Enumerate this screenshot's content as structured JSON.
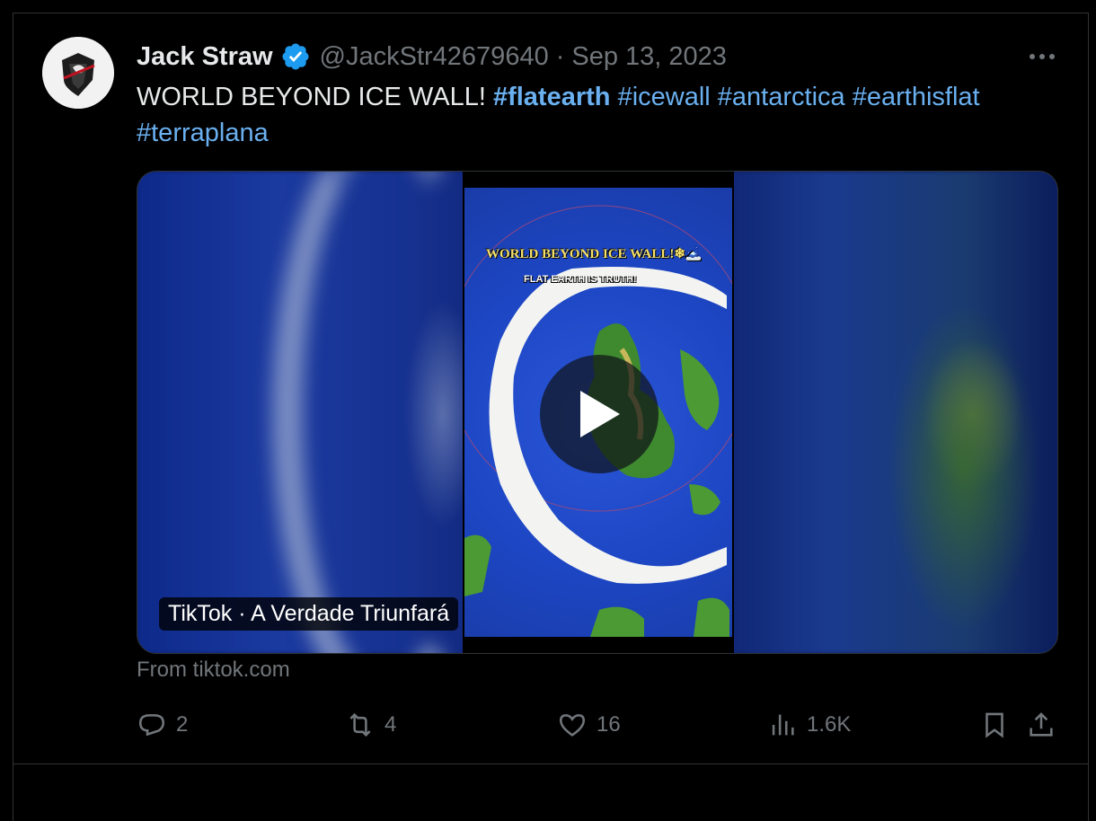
{
  "tweet": {
    "author_name": "Jack Straw",
    "handle": "@JackStr42679640",
    "separator": "·",
    "date": "Sep 13, 2023",
    "text": "WORLD BEYOND ICE WALL!",
    "hashtags": [
      "#flatearth",
      "#icewall",
      "#antarctica",
      "#earthisflat",
      "#terraplana"
    ]
  },
  "media": {
    "overlay_title": "WORLD BEYOND ICE WALL!❄🗻",
    "overlay_subtitle": "FLAT EARTH IS TRUTH!",
    "caption": "TikTok · A Verdade Triunfará",
    "source": "From tiktok.com"
  },
  "actions": {
    "replies": "2",
    "reposts": "4",
    "likes": "16",
    "views": "1.6K"
  },
  "colors": {
    "background": "#000000",
    "primary_text": "#e7e9ea",
    "secondary_text": "#71767b",
    "link": "#6ab0f0",
    "verified": "#1d9bf0",
    "border": "#2f3336"
  },
  "icons": {
    "verified": "verified-badge-icon",
    "more": "more-icon",
    "play": "play-icon",
    "reply": "reply-icon",
    "repost": "repost-icon",
    "like": "like-icon",
    "views": "views-icon",
    "bookmark": "bookmark-icon",
    "share": "share-icon"
  }
}
